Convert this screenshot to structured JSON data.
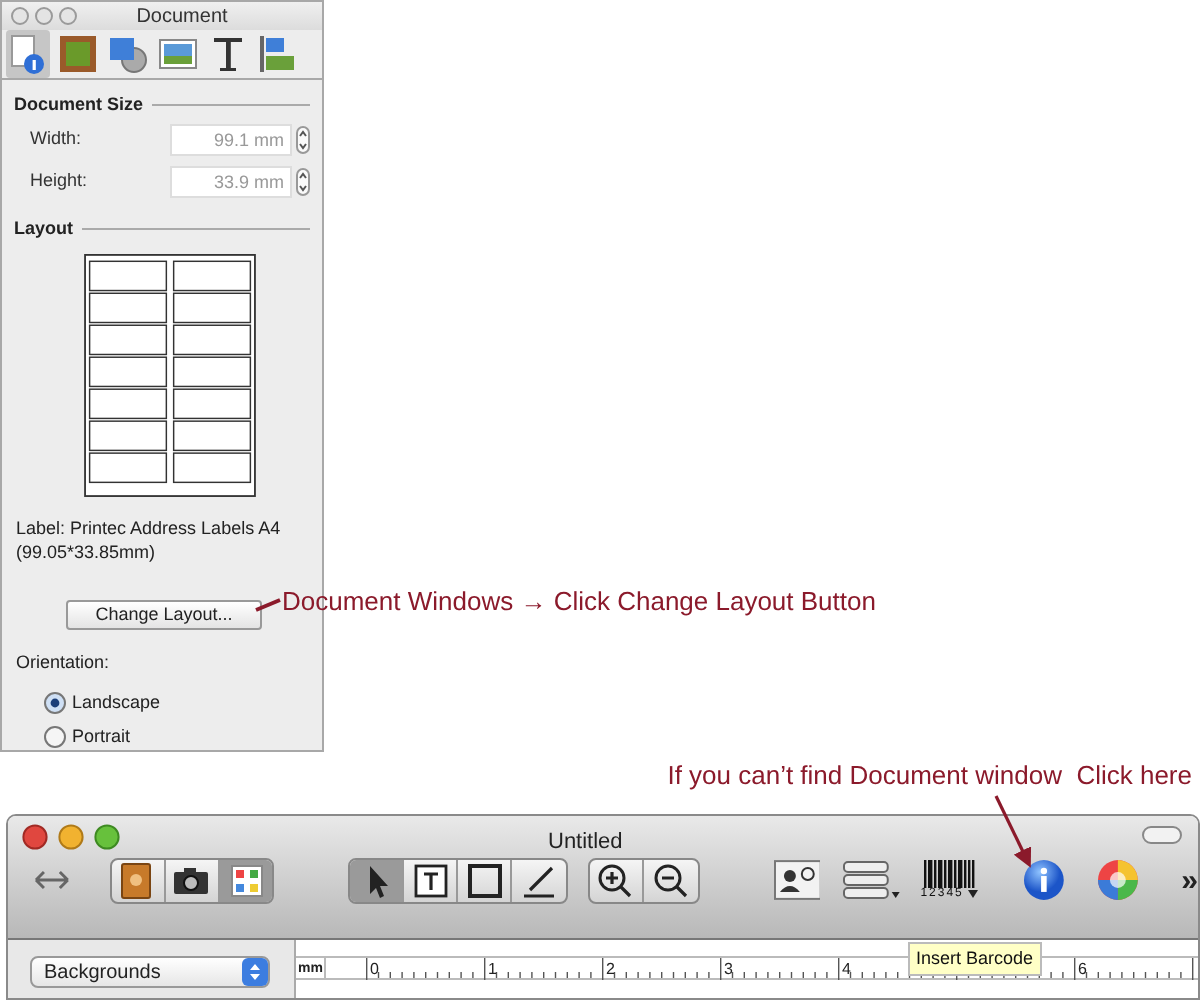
{
  "inspector": {
    "title": "Document",
    "tabs": [
      {
        "kind": "info",
        "selected": true
      },
      {
        "kind": "frame",
        "selected": false
      },
      {
        "kind": "shapes",
        "selected": false
      },
      {
        "kind": "image",
        "selected": false
      },
      {
        "kind": "text",
        "selected": false
      },
      {
        "kind": "align",
        "selected": false
      }
    ],
    "document_size": {
      "heading": "Document Size",
      "fields": [
        {
          "label": "Width:",
          "value": "99.1 mm"
        },
        {
          "label": "Height:",
          "value": "33.9 mm"
        }
      ]
    },
    "layout": {
      "heading": "Layout",
      "label_lines": [
        "Label: Printec Address Labels A4",
        "(99.05*33.85mm)"
      ],
      "button": "Change Layout..."
    },
    "orientation": {
      "label": "Orientation:",
      "options": [
        {
          "label": "Landscape",
          "selected": true
        },
        {
          "label": "Portrait",
          "selected": false
        }
      ]
    }
  },
  "annotations": [
    "Document Windows → Click Change Layout Button",
    "If you can’t find Document window  Click here"
  ],
  "main_window": {
    "title": "Untitled",
    "toolbar_groups": [
      {
        "items": [
          {
            "kind": "book",
            "selected": false
          },
          {
            "kind": "camera",
            "selected": false
          },
          {
            "kind": "palette",
            "selected": true
          }
        ]
      },
      {
        "items": [
          {
            "kind": "pointer",
            "selected": true
          },
          {
            "kind": "text",
            "selected": false
          },
          {
            "kind": "rect",
            "selected": false
          },
          {
            "kind": "line",
            "selected": false
          }
        ]
      },
      {
        "items": [
          {
            "kind": "zoom-in",
            "selected": false
          },
          {
            "kind": "zoom-out",
            "selected": false
          }
        ]
      }
    ],
    "barcode_digits": "12345",
    "overflow": "»",
    "background_select": "Backgrounds",
    "ruler": {
      "unit": "mm",
      "marks": [
        "0",
        "1",
        "2",
        "3",
        "4",
        "6"
      ]
    },
    "tooltip": "Insert Barcode"
  }
}
